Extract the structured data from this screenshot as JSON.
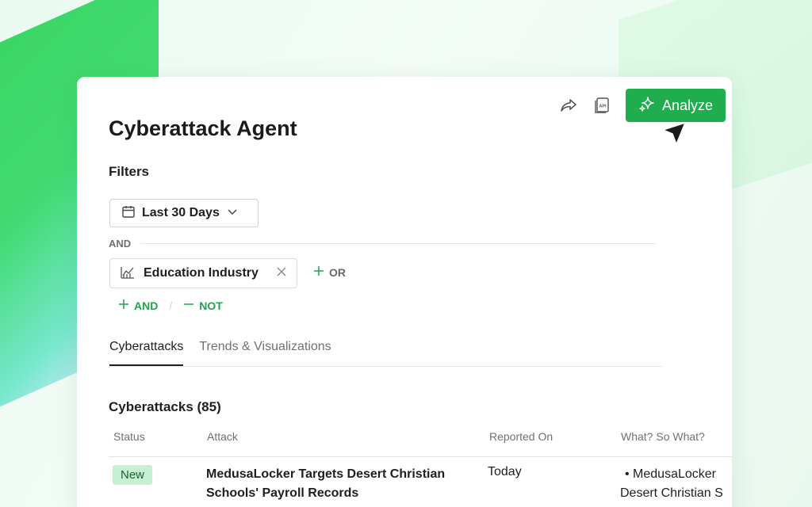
{
  "app": {
    "title": "Cyberattack Agent"
  },
  "toolbar": {
    "share_icon": "share-arrow-icon",
    "api_icon": "api-document-icon",
    "api_icon_text": "API",
    "analyze_label": "Analyze",
    "analyze_icon": "sparkles-icon"
  },
  "filters": {
    "label": "Filters",
    "date_filter": {
      "label": "Last 30 Days",
      "icon": "calendar-icon"
    },
    "connector": "AND",
    "industry_filter": {
      "label": "Education Industry",
      "icon": "industry-icon"
    },
    "or_label": "OR",
    "and_label": "AND",
    "not_label": "NOT"
  },
  "tabs": [
    {
      "label": "Cyberattacks",
      "active": true
    },
    {
      "label": "Trends & Visualizations",
      "active": false
    }
  ],
  "table": {
    "title": "Cyberattacks (85)",
    "columns": [
      "Status",
      "Attack",
      "Reported On",
      "What? So What?"
    ],
    "rows": [
      {
        "status": "New",
        "attack": "MedusaLocker Targets Desert Christian Schools' Payroll Records",
        "reported_on": "Today",
        "what_line1": "• MedusaLocker",
        "what_line2": "Desert Christian S"
      }
    ]
  },
  "colors": {
    "accent": "#1fad4e",
    "badge_bg": "#c7efd2",
    "link_green": "#22a34f"
  }
}
